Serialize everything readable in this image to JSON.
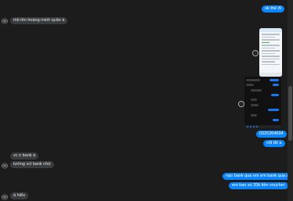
{
  "messages": {
    "m1": "ok thế đi",
    "m2": "mb tên hoàng minh quân á",
    "m3": "0325364694",
    "m4": "vốt đó a",
    "m5": "vc n bank á",
    "m6": "tường vcl bank chứ",
    "m7": "nạo bank qua em em bank qua a",
    "m8": "em bao sò 20k tiền voucher",
    "m9": "à hiểu"
  },
  "avatar_label": "(ᵔᴥᵔ)",
  "icons": {
    "avatar": "user-avatar-icon",
    "warning": "alert-circle-icon"
  }
}
